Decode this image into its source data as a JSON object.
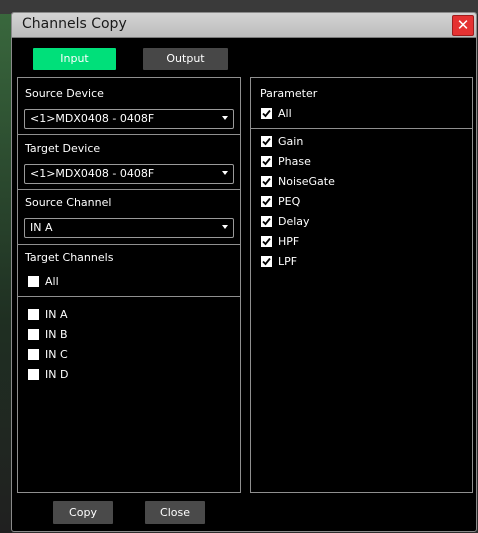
{
  "window": {
    "title": "Channels Copy",
    "close_glyph": "✕"
  },
  "tabs": {
    "input": "Input",
    "output": "Output",
    "active": "input"
  },
  "left": {
    "source_device": {
      "label": "Source Device",
      "value": "<1>MDX0408 - 0408F"
    },
    "target_device": {
      "label": "Target Device",
      "value": "<1>MDX0408 - 0408F"
    },
    "source_channel": {
      "label": "Source Channel",
      "value": "IN A"
    },
    "target_channels": {
      "label": "Target Channels",
      "all": {
        "label": "All",
        "checked": false
      },
      "items": [
        {
          "label": "IN A",
          "checked": false
        },
        {
          "label": "IN B",
          "checked": false
        },
        {
          "label": "IN C",
          "checked": false
        },
        {
          "label": "IN D",
          "checked": false
        }
      ]
    }
  },
  "right": {
    "label": "Parameter",
    "all": {
      "label": "All",
      "checked": true
    },
    "items": [
      {
        "label": "Gain",
        "checked": true
      },
      {
        "label": "Phase",
        "checked": true
      },
      {
        "label": "NoiseGate",
        "checked": true
      },
      {
        "label": "PEQ",
        "checked": true
      },
      {
        "label": "Delay",
        "checked": true
      },
      {
        "label": "HPF",
        "checked": true
      },
      {
        "label": "LPF",
        "checked": true
      }
    ]
  },
  "buttons": {
    "copy": "Copy",
    "close": "Close"
  },
  "colors": {
    "accent": "#00e07a",
    "close_red": "#e53232"
  }
}
